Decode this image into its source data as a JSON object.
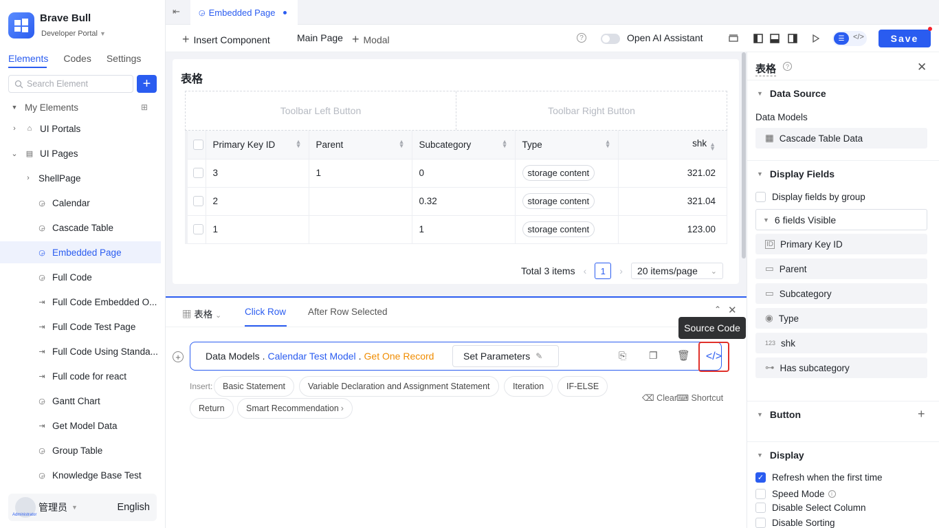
{
  "app": {
    "title": "Brave Bull",
    "portal": "Developer Portal"
  },
  "left_tabs": [
    "Elements",
    "Codes",
    "Settings"
  ],
  "search_placeholder": "Search Element",
  "tree": {
    "root": "My Elements",
    "items": [
      "UI Portals",
      "UI Pages",
      "ShellPage",
      "Calendar",
      "Cascade Table",
      "Embedded Page",
      "Full Code",
      "Full Code Embedded O...",
      "Full Code Test Page",
      "Full Code Using Standa...",
      "Full code for react",
      "Gantt Chart",
      "Get Model Data",
      "Group Table",
      "Knowledge Base Test"
    ]
  },
  "user": {
    "name": "管理员",
    "role": "Administrator",
    "language": "English"
  },
  "doc_tab": "Embedded Page",
  "toolbar": {
    "insert": "Insert Component",
    "main_page": "Main Page",
    "modal": "Modal",
    "ai": "Open AI Assistant",
    "save": "Save"
  },
  "table_card": {
    "title": "表格",
    "left_btn": "Toolbar Left Button",
    "right_btn": "Toolbar Right Button",
    "headers": [
      "Primary Key ID",
      "Parent",
      "Subcategory",
      "Type",
      "shk"
    ],
    "rows": [
      [
        "3",
        "1",
        "0",
        "storage content",
        "321.02"
      ],
      [
        "2",
        "",
        "0.32",
        "storage content",
        "321.04"
      ],
      [
        "1",
        "",
        "1",
        "storage content",
        "123.00"
      ]
    ],
    "total": "Total 3 items",
    "page": "1",
    "page_size": "20 items/page"
  },
  "events": {
    "component": "表格",
    "tabs": [
      "Click Row",
      "After Row Selected"
    ],
    "stmt": {
      "p1": "Data Models",
      "p2": "Calendar Test Model",
      "p3": "Get One Record",
      "params": "Set Parameters"
    },
    "insert_label": "Insert:",
    "chips": [
      "Basic Statement",
      "Variable Declaration and Assignment Statement",
      "Iteration",
      "IF-ELSE",
      "Return",
      "Smart Recommendation"
    ],
    "clear": "Clear",
    "shortcut": "Shortcut",
    "tooltip": "Source Code"
  },
  "right": {
    "title": "表格",
    "data_source": "Data Source",
    "data_models": "Data Models",
    "model": "Cascade Table Data",
    "display_fields": "Display Fields",
    "by_group": "Display fields by group",
    "visible": "6 fields Visible",
    "fields": [
      "Primary Key ID",
      "Parent",
      "Subcategory",
      "Type",
      "shk",
      "Has subcategory"
    ],
    "button": "Button",
    "display": "Display",
    "opts": [
      "Refresh when the first time",
      "Speed Mode",
      "Disable Select Column",
      "Disable Sorting"
    ]
  }
}
